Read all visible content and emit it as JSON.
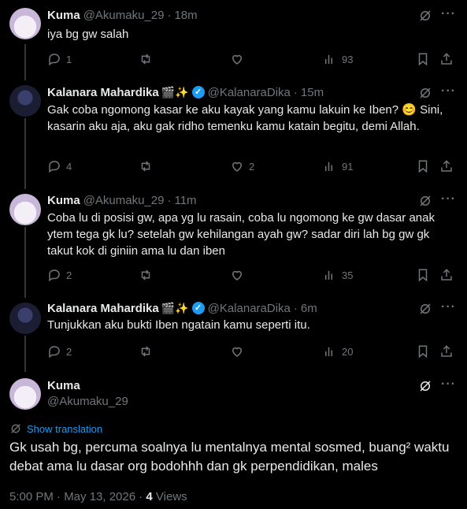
{
  "tweets": [
    {
      "name": "Kuma",
      "emoji": "",
      "handle": "@Akumaku_29",
      "time": "18m",
      "text": "iya bg gw salah",
      "replies": "1",
      "likes": "",
      "views": "93",
      "avatar": "kuma"
    },
    {
      "name": "Kalanara Mahardika",
      "emoji": "🎬✨",
      "handle": "@KalanaraDika",
      "time": "15m",
      "text": "Gak coba ngomong kasar ke aku kayak yang kamu lakuin ke Iben? 😊 Sini, kasarin aku aja, aku gak ridho temenku kamu katain begitu, demi Allah.",
      "replies": "4",
      "likes": "2",
      "views": "91",
      "avatar": "kala"
    },
    {
      "name": "Kuma",
      "emoji": "",
      "handle": "@Akumaku_29",
      "time": "11m",
      "text": "Coba lu di posisi gw, apa yg lu rasain, coba lu ngomong ke gw dasar anak ytem tega gk lu? setelah gw kehilangan ayah gw? sadar diri lah bg gw gk takut kok di giniin ama lu dan iben",
      "replies": "2",
      "likes": "",
      "views": "35",
      "avatar": "kuma"
    },
    {
      "name": "Kalanara Mahardika",
      "emoji": "🎬✨",
      "handle": "@KalanaraDika",
      "time": "6m",
      "text": "Tunjukkan aku bukti Iben ngatain kamu seperti itu.",
      "replies": "2",
      "likes": "",
      "views": "20",
      "avatar": "kala"
    }
  ],
  "main_tweet": {
    "name": "Kuma",
    "handle": "@Akumaku_29",
    "show_translation": "Show translation",
    "text": "Gk usah bg, percuma soalnya lu mentalnya mental sosmed, buang² waktu debat ama lu dasar org bodohhh dan gk perpendidikan, males",
    "time": "5:00 PM · May 13, 2026 · ",
    "views_count": "4",
    "views_label": " Views"
  },
  "icons": [
    "grok-icon",
    "more-icon",
    "reply-icon",
    "retweet-icon",
    "like-icon",
    "views-icon",
    "bookmark-icon",
    "share-icon",
    "translate-icon",
    "verified-icon"
  ],
  "colors": {
    "background": "#000000",
    "text": "#e7e9ea",
    "muted": "#71767b",
    "accent": "#1d9bf0",
    "divider": "#2f3336"
  }
}
